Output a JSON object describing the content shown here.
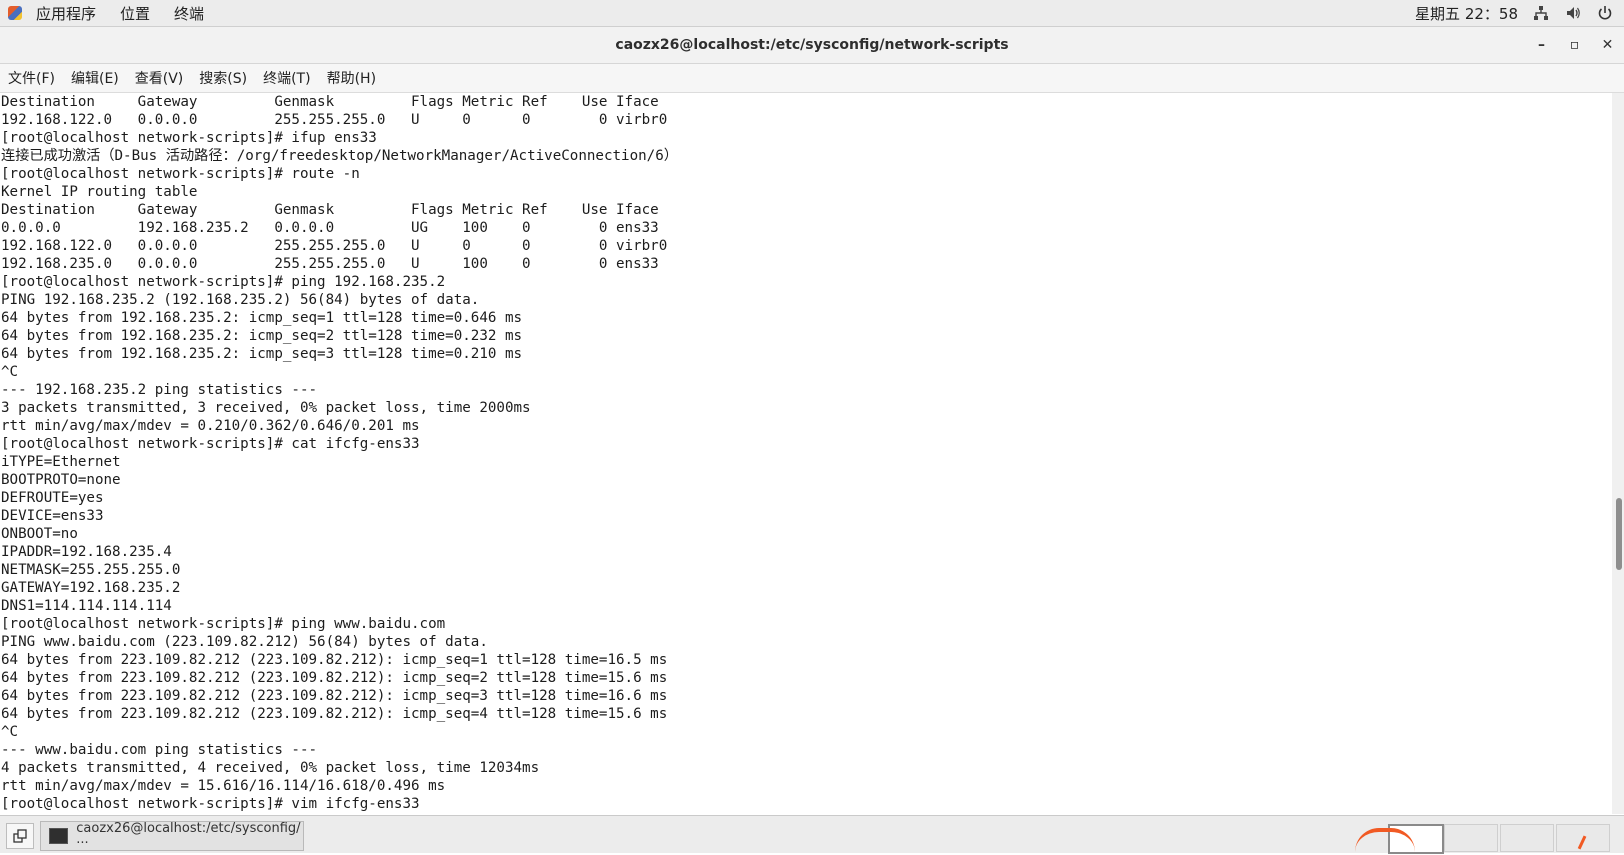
{
  "top_panel": {
    "menus": [
      "应用程序",
      "位置",
      "终端"
    ],
    "clock": "星期五 22：58",
    "icons": [
      "network-icon",
      "volume-icon",
      "power-icon"
    ]
  },
  "window": {
    "title": "caozx26@localhost:/etc/sysconfig/network-scripts",
    "minimize": "–",
    "maximize": "▫",
    "close": "✕"
  },
  "menu_bar": {
    "items": [
      "文件(F)",
      "编辑(E)",
      "查看(V)",
      "搜索(S)",
      "终端(T)",
      "帮助(H)"
    ]
  },
  "terminal": {
    "lines": [
      "Destination     Gateway         Genmask         Flags Metric Ref    Use Iface",
      "192.168.122.0   0.0.0.0         255.255.255.0   U     0      0        0 virbr0",
      "[root@localhost network-scripts]# ifup ens33",
      "连接已成功激活（D-Bus 活动路径：/org/freedesktop/NetworkManager/ActiveConnection/6）",
      "[root@localhost network-scripts]# route -n",
      "Kernel IP routing table",
      "Destination     Gateway         Genmask         Flags Metric Ref    Use Iface",
      "0.0.0.0         192.168.235.2   0.0.0.0         UG    100    0        0 ens33",
      "192.168.122.0   0.0.0.0         255.255.255.0   U     0      0        0 virbr0",
      "192.168.235.0   0.0.0.0         255.255.255.0   U     100    0        0 ens33",
      "[root@localhost network-scripts]# ping 192.168.235.2",
      "PING 192.168.235.2 (192.168.235.2) 56(84) bytes of data.",
      "64 bytes from 192.168.235.2: icmp_seq=1 ttl=128 time=0.646 ms",
      "64 bytes from 192.168.235.2: icmp_seq=2 ttl=128 time=0.232 ms",
      "64 bytes from 192.168.235.2: icmp_seq=3 ttl=128 time=0.210 ms",
      "^C",
      "--- 192.168.235.2 ping statistics ---",
      "3 packets transmitted, 3 received, 0% packet loss, time 2000ms",
      "rtt min/avg/max/mdev = 0.210/0.362/0.646/0.201 ms",
      "[root@localhost network-scripts]# cat ifcfg-ens33",
      "iTYPE=Ethernet",
      "BOOTPROTO=none",
      "DEFROUTE=yes",
      "DEVICE=ens33",
      "ONBOOT=no",
      "IPADDR=192.168.235.4",
      "NETMASK=255.255.255.0",
      "GATEWAY=192.168.235.2",
      "DNS1=114.114.114.114",
      "[root@localhost network-scripts]# ping www.baidu.com",
      "PING www.baidu.com (223.109.82.212) 56(84) bytes of data.",
      "64 bytes from 223.109.82.212 (223.109.82.212): icmp_seq=1 ttl=128 time=16.5 ms",
      "64 bytes from 223.109.82.212 (223.109.82.212): icmp_seq=2 ttl=128 time=15.6 ms",
      "64 bytes from 223.109.82.212 (223.109.82.212): icmp_seq=3 ttl=128 time=16.6 ms",
      "64 bytes from 223.109.82.212 (223.109.82.212): icmp_seq=4 ttl=128 time=15.6 ms",
      "^C",
      "--- www.baidu.com ping statistics ---",
      "4 packets transmitted, 4 received, 0% packet loss, time 12034ms",
      "rtt min/avg/max/mdev = 15.616/16.114/16.618/0.496 ms",
      "[root@localhost network-scripts]# vim ifcfg-ens33"
    ]
  },
  "taskbar": {
    "task_label": "caozx26@localhost:/etc/sysconfig/···",
    "workspaces_count": 4
  },
  "colors": {
    "panel_bg": "#ececec",
    "terminal_bg": "#ffffff",
    "terminal_fg": "#1c1c1c",
    "annotation": "#f15a24"
  }
}
